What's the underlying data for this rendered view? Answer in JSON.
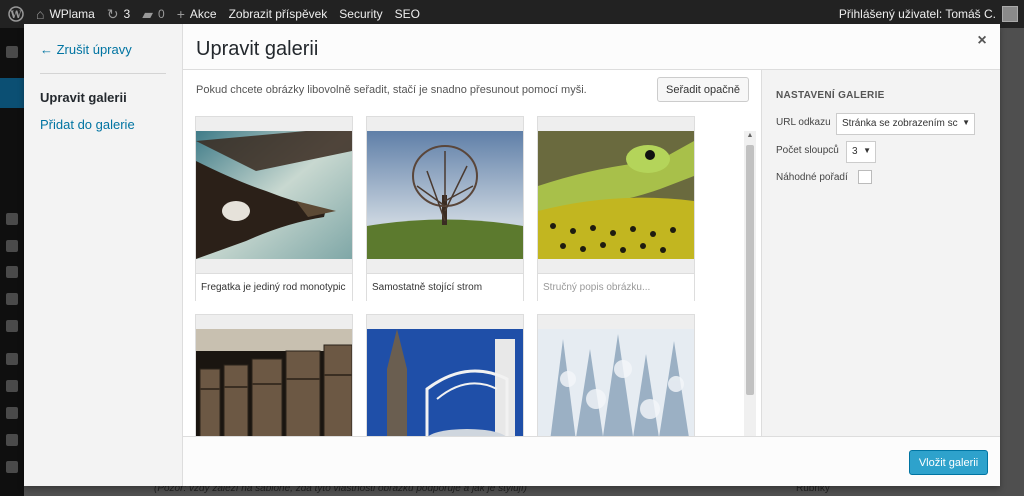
{
  "admin_bar": {
    "site_name": "WPlama",
    "updates_count": "3",
    "comments_count": "0",
    "new_label": "Akce",
    "view_post_label": "Zobrazit příspěvek",
    "security_label": "Security",
    "seo_label": "SEO",
    "logged_in_label": "Přihlášený uživatel: Tomáš C."
  },
  "background": {
    "note_text": "(Pozor: vždy záleží na šabloně, zda tyto vlastnosti obrázků podporuje a jak je stylují)",
    "sidebar_widget_title": "Rubriky"
  },
  "media_menu": {
    "cancel_label": "← Zrušit úpravy",
    "items": [
      {
        "label": "Upravit galerii"
      },
      {
        "label": "Přidat do galerie"
      }
    ]
  },
  "modal": {
    "title": "Upravit galerii",
    "close_label": "×"
  },
  "gallery": {
    "instructions": "Pokud chcete obrázky libovolně seřadit, stačí je snadno přesunout pomocí myši.",
    "reverse_button_label": "Seřadit opačně",
    "items": [
      {
        "caption": "Fregatka je jediný rod monotypic",
        "image": "frigatebird-photo"
      },
      {
        "caption": "Samostatně stojící strom",
        "image": "lone-tree-photo"
      },
      {
        "caption": "",
        "caption_placeholder": "Stručný popis obrázku...",
        "image": "green-snake-photo"
      },
      {
        "caption": "",
        "image": "prayer-wheels-photo"
      },
      {
        "caption": "",
        "image": "cathedral-tower-photo"
      },
      {
        "caption": "",
        "image": "snowy-forest-photo"
      }
    ]
  },
  "settings": {
    "heading": "NASTAVENÍ GALERIE",
    "link_to_label": "URL odkazu",
    "link_to_value": "Stránka se zobrazením sc",
    "columns_label": "Počet sloupců",
    "columns_value": "3",
    "random_order_label": "Náhodné pořadí",
    "random_order_checked": false
  },
  "toolbar": {
    "insert_button_label": "Vložit galerii"
  }
}
